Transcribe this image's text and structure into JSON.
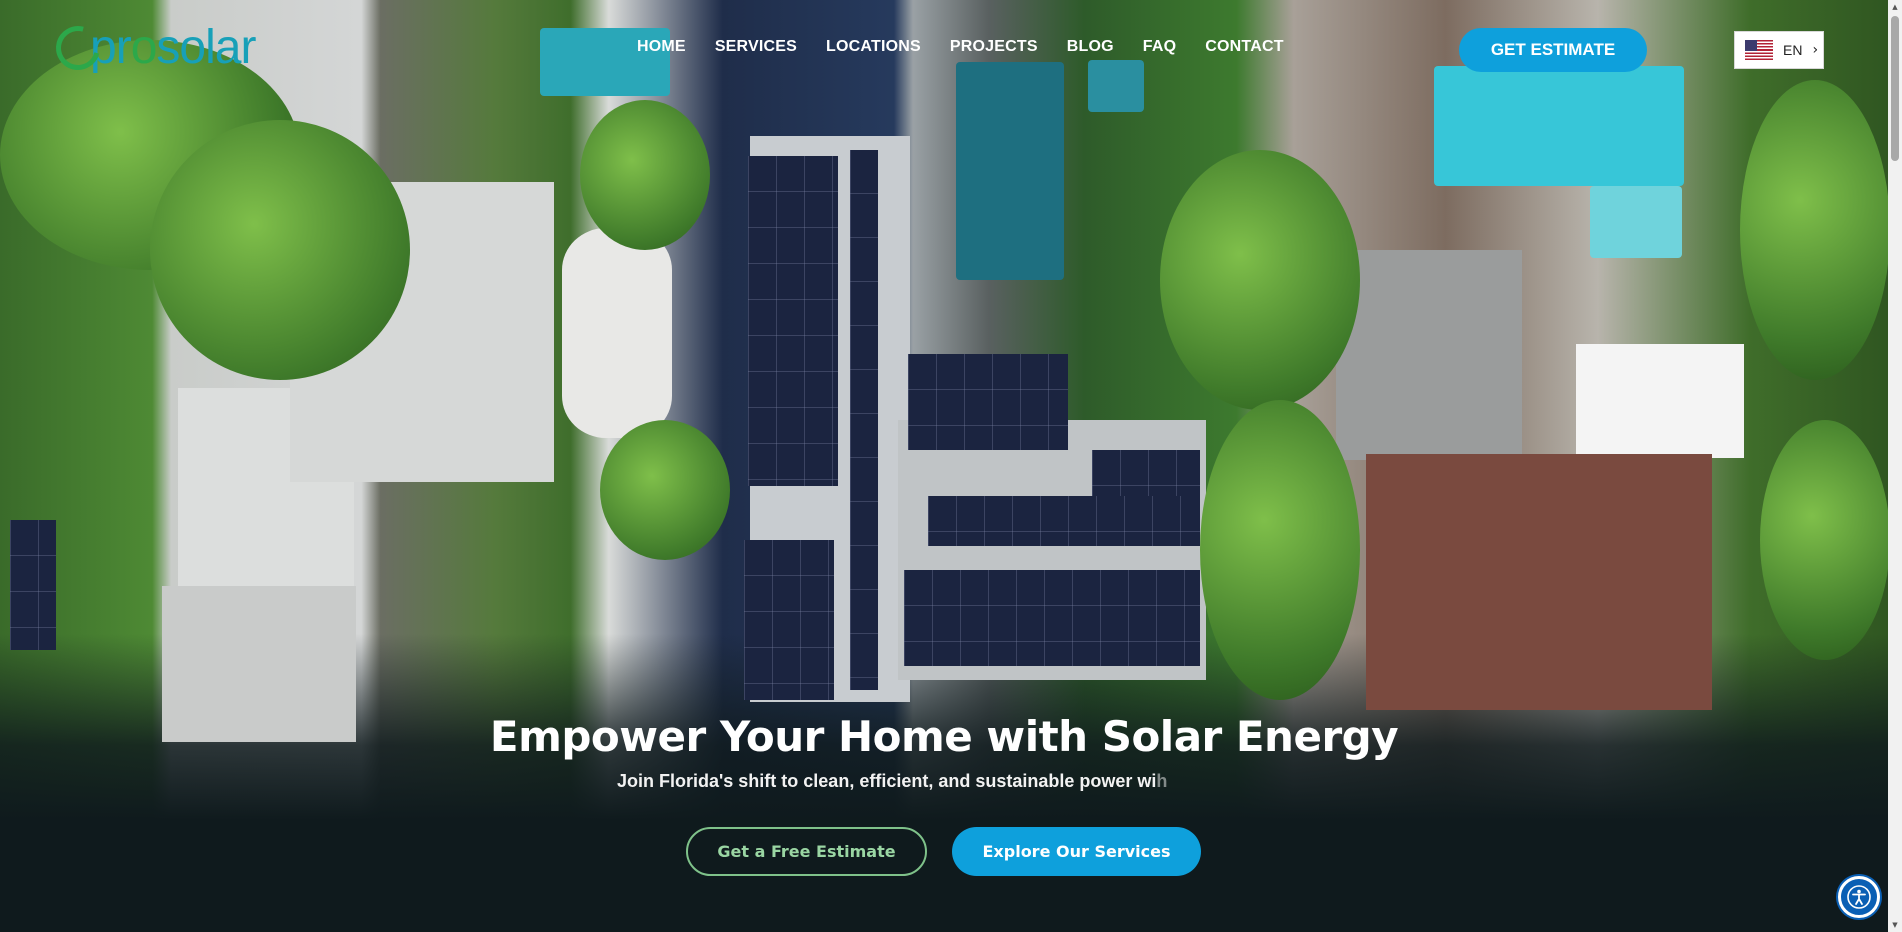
{
  "brand": {
    "name_pre": "pr",
    "name_o": "o",
    "name_post": "solar"
  },
  "nav": {
    "items": [
      {
        "label": "HOME"
      },
      {
        "label": "SERVICES"
      },
      {
        "label": "LOCATIONS"
      },
      {
        "label": "PROJECTS"
      },
      {
        "label": "BLOG"
      },
      {
        "label": "FAQ"
      },
      {
        "label": "CONTACT"
      }
    ],
    "estimate_label": "GET ESTIMATE"
  },
  "language": {
    "code": "EN",
    "flag_icon": "us-flag-icon",
    "chevron": "›"
  },
  "hero": {
    "title": "Empower Your Home with Solar Energy",
    "subtitle": "Join Florida's shift to clean, efficient, and sustainable power wi",
    "subtitle_tail": "h",
    "cta_primary": "Get a Free Estimate",
    "cta_secondary": "Explore Our Services"
  },
  "colors": {
    "accent_blue": "#0ea0dc",
    "accent_green": "#2ca84a",
    "logo_teal": "#17a0b8",
    "background": "#0f1a1d",
    "accessibility_blue": "#0a5fb4"
  },
  "icons": {
    "accessibility": "accessibility-icon",
    "scroll_up": "scroll-up-arrow-icon",
    "scroll_down": "scroll-down-arrow-icon"
  }
}
